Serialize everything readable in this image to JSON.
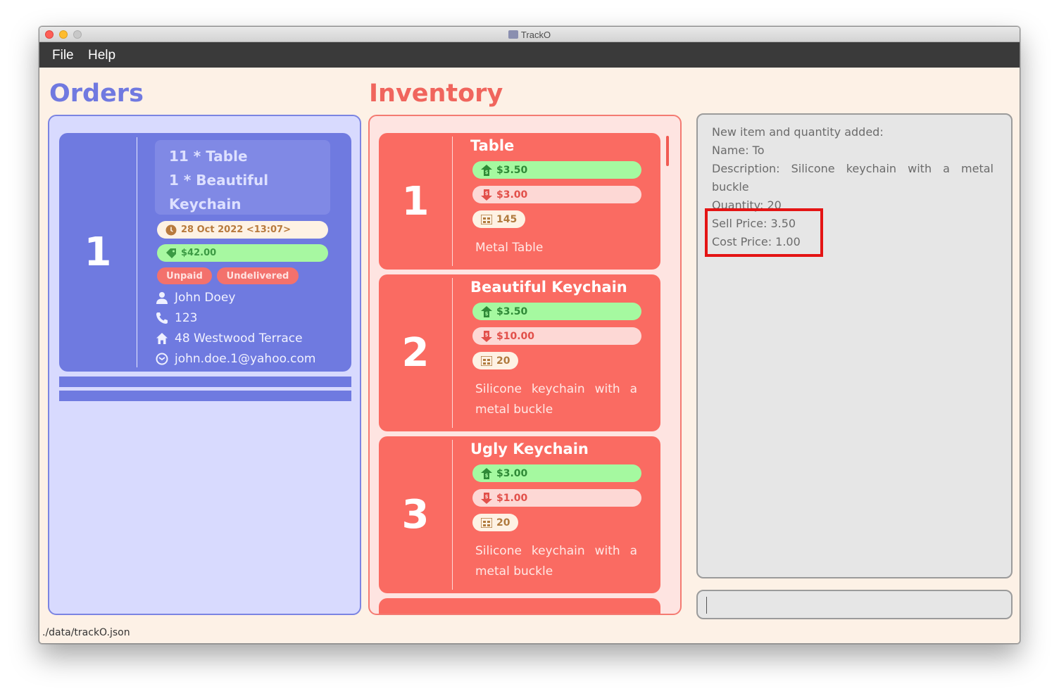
{
  "window": {
    "title": "TrackO"
  },
  "menu": {
    "file": "File",
    "help": "Help"
  },
  "sections": {
    "orders": "Orders",
    "inventory": "Inventory"
  },
  "order": {
    "index": "1",
    "items": [
      "11 * Table",
      "1 * Beautiful",
      "Keychain"
    ],
    "date": "28 Oct 2022 <13:07>",
    "total": "$42.00",
    "payment_status": "Unpaid",
    "delivery_status": "Undelivered",
    "customer_name": "John Doey",
    "phone": "123",
    "address": "48 Westwood Terrace",
    "email": "john.doe.1@yahoo.com"
  },
  "inventory": [
    {
      "index": "1",
      "name": "Table",
      "sell": "$3.50",
      "cost": "$3.00",
      "qty": "145",
      "desc": "Metal Table"
    },
    {
      "index": "2",
      "name": "Beautiful Keychain",
      "sell": "$3.50",
      "cost": "$10.00",
      "qty": "20",
      "desc": "Silicone keychain with a metal buckle"
    },
    {
      "index": "3",
      "name": "Ugly Keychain",
      "sell": "$3.00",
      "cost": "$1.00",
      "qty": "20",
      "desc": "Silicone keychain with a metal buckle"
    }
  ],
  "result": {
    "line1": "New item and quantity added:",
    "line2": "Name: To",
    "line3": "Description: Silicone keychain with a metal buckle",
    "line4": "Quantity: 20",
    "line5": "Sell Price: 3.50",
    "line6": "Cost Price: 1.00"
  },
  "command": {
    "value": ""
  },
  "status": {
    "path": "./data/trackO.json"
  },
  "colors": {
    "orders_accent": "#7079e0",
    "inventory_accent": "#f0655d",
    "sell_green": "#a5f9a0",
    "cost_pink": "#fdd8d5",
    "highlight_red": "#e41414"
  }
}
